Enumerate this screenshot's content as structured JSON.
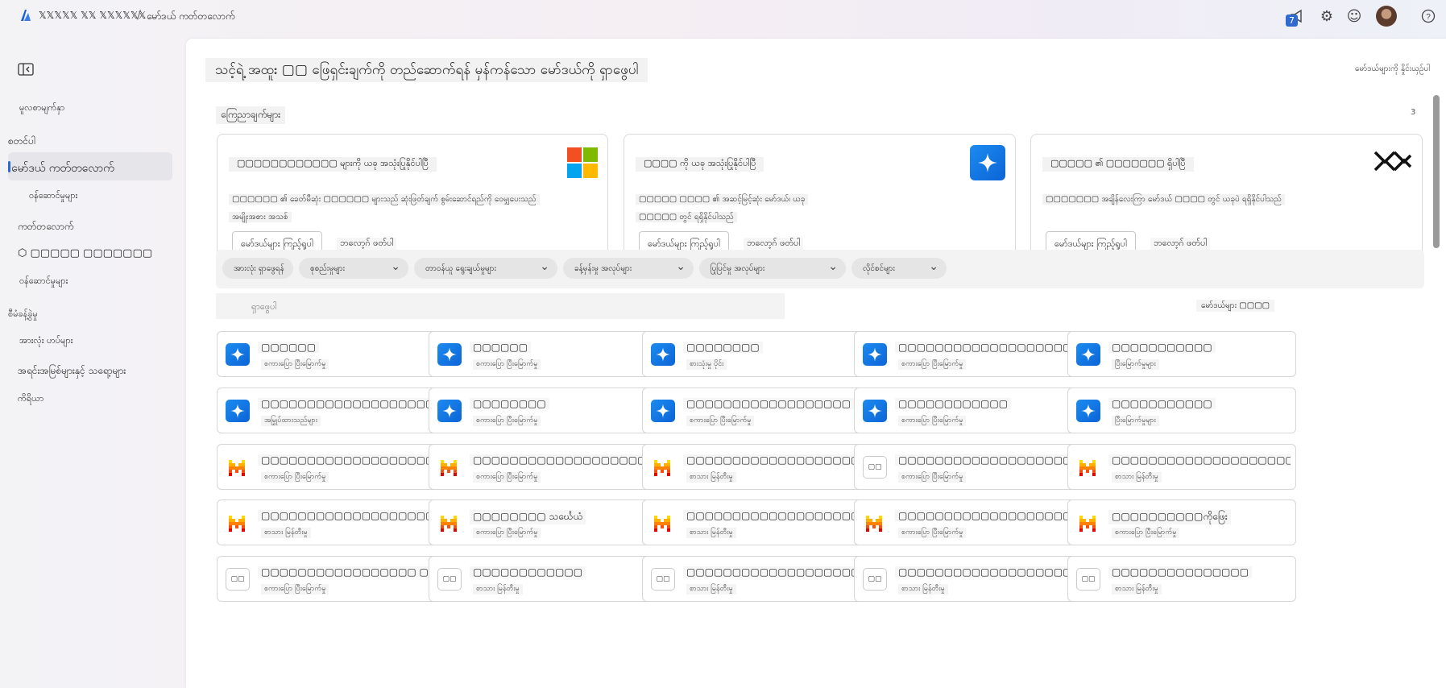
{
  "topbar": {
    "brand": "𝕏𝕏𝕏𝕏𝕏 𝕏𝕏 𝕏𝕏𝕏𝕏𝕏𝕏",
    "breadcrumb": "မော်ဒယ် ကတ်တလောက်",
    "notification_count": "7"
  },
  "sidebar": {
    "items": [
      {
        "label": "မူလစာမျက်နှာ"
      },
      {
        "label": "စတင်ပါ"
      },
      {
        "label": "မော်ဒယ် ကတ်တလောက်"
      },
      {
        "label": "ဝန်ဆောင်မှုများ"
      },
      {
        "label": "ကတ်တလောက်"
      },
      {
        "label": "▢▢▢▢▢ ▢▢▢▢▢▢▢"
      },
      {
        "label": "ဝန်ဆောင်မှုများ"
      }
    ],
    "section_label": "စီမံခန့်ခွဲမှု",
    "bottom_items": [
      {
        "label": "အားလုံး ဟပ်များ"
      },
      {
        "label": "အရင်းအမြစ်များနှင့် သရော့များ"
      },
      {
        "label": "ကိရိယာ"
      }
    ]
  },
  "main": {
    "hero_title": "သင့်ရဲ့ အထူး ▢▢ ဖြေရှင်းချက်ကို တည်ဆောက်ရန် မှန်ကန်သော မော်ဒယ်ကို ရှာဖွေပါ",
    "compare_link": "မော်ဒယ်များကို နှိုင်းယှဉ်ပါ",
    "featured_label": "ကြေညာချက်များ",
    "featured_count": "3",
    "featured": [
      {
        "title": "▢▢▢▢▢▢▢▢▢▢▢▢ များကို ယခု အသုံးပြုနိုင်ပါပြီ",
        "description_1": "▢▢▢▢▢▢ ၏ ခေတ်မီဆုံး ▢▢▢▢▢▢ များသည် ဆုံးဖြတ်ချက် စွမ်းဆောင်ရည်ကို ဝေမျှပေးသည်",
        "description_2": "အမျိုးအစား အသစ်",
        "button": "မော်ဒယ်များ ကြည့်ရှုပါ",
        "link": "ဘလော့ဂ် ဖတ်ပါ"
      },
      {
        "title": "▢▢▢▢ ကို ယခု အသုံးပြုနိုင်ပါပြီ",
        "description_1": "▢▢▢▢▢ ▢▢▢▢ ၏ အဆင့်မြင့်ဆုံး မော်ဒယ်၊ ယခု",
        "description_2": "▢▢▢▢▢ တွင် ရရှိနိုင်ပါသည်",
        "button": "မော်ဒယ်များ ကြည့်ရှုပါ",
        "link": "ဘလော့ဂ် ဖတ်ပါ"
      },
      {
        "title": "▢▢▢▢▢ ၏ ▢▢▢▢▢▢▢ ရှိပါပြီ",
        "description_1": "▢▢▢▢▢▢▢ အချိန်လေးကြာ မော်ဒယ် ▢▢▢▢ တွင် ယခုပဲ ရရှိနိုင်ပါသည်",
        "description_2": "",
        "button": "မော်ဒယ်များ ကြည့်ရှုပါ",
        "link": "ဘလော့ဂ် ဖတ်ပါ"
      }
    ],
    "filters": [
      "အားလုံး ရှာဖွေရန်",
      "စုစည်းမှုများ",
      "တာဝန်ယူ ရွေးချယ်မှုများ",
      "ခန့်မှန်းမှု အလုပ်များ",
      "ပြုပြင်မှု အလုပ်များ",
      "လိုင်စင်များ"
    ],
    "search_placeholder": "ရှာဖွေပါ",
    "model_count": "မော်ဒယ်များ ▢▢▢▢",
    "models": [
      {
        "name": "▢▢▢▢▢▢",
        "task": "စကားပြော ပြီးမြောက်မှု",
        "icon": "star"
      },
      {
        "name": "▢▢▢▢▢▢",
        "task": "စကားပြော ပြီးမြောက်မှု",
        "icon": "star"
      },
      {
        "name": "▢▢▢▢▢▢▢▢",
        "task": "စားသုံးမှု ပိုင်း",
        "icon": "star"
      },
      {
        "name": "▢▢▢▢▢▢▢▢▢▢▢▢▢▢▢▢▢▢▢",
        "task": "စကားပြော ပြီးမြောက်မှု",
        "icon": "star"
      },
      {
        "name": "▢▢▢▢▢▢▢▢▢▢▢",
        "task": "ပြီးမြောက်မှုများ",
        "icon": "star"
      },
      {
        "name": "▢▢▢▢▢▢▢▢▢▢▢▢▢▢▢▢▢▢▢▢▢▢▢",
        "task": "အမြှုပ်ထားသည်များ",
        "icon": "star"
      },
      {
        "name": "▢▢▢▢▢▢▢▢",
        "task": "စကားပြော ပြီးမြောက်မှု",
        "icon": "star"
      },
      {
        "name": "▢▢▢▢▢▢▢▢▢▢▢▢▢▢▢▢▢▢",
        "task": "စကားပြော ပြီးမြောက်မှု",
        "icon": "star"
      },
      {
        "name": "▢▢▢▢▢▢▢▢▢▢▢▢",
        "task": "စကားပြော ပြီးမြောက်မှု",
        "icon": "star"
      },
      {
        "name": "▢▢▢▢▢▢▢▢▢▢▢",
        "task": "ပြီးမြောက်မှုများ",
        "icon": "star"
      },
      {
        "name": "▢▢▢▢▢▢▢▢▢▢▢▢▢▢▢▢▢▢▢▢▢▢▢▢▢▢▢▢",
        "task": "စကားပြော ပြီးမြောက်မှု",
        "icon": "mistral"
      },
      {
        "name": "▢▢▢▢▢▢▢▢▢▢▢▢▢▢▢▢▢▢▢▢▢▢▢▢▢▢",
        "task": "စကားပြော ပြီးမြောက်မှု",
        "icon": "mistral"
      },
      {
        "name": "▢▢▢▢▢▢▢▢▢▢▢▢▢▢▢▢▢▢▢▢▢▢▢▢",
        "task": "စာသား မြန်တီးမှု",
        "icon": "mistral"
      },
      {
        "name": "▢▢▢▢▢▢▢▢▢▢▢▢▢▢▢▢▢▢▢▢▢▢▢▢",
        "task": "စကားပြော ပြီးမြောက်မှု",
        "icon": "plain"
      },
      {
        "name": "▢▢▢▢▢▢▢▢▢▢▢▢▢▢▢▢▢▢▢▢▢▢▢▢▢▢",
        "task": "စာသား မြန်တီးမှု",
        "icon": "mistral"
      },
      {
        "name": "▢▢▢▢▢▢▢▢▢▢▢▢▢▢▢▢▢▢▢▢▢▢▢",
        "task": "စာသား မြန်တီးမှု",
        "icon": "mistral"
      },
      {
        "name": "▢▢▢▢▢▢▢▢ သင်္ဃေယံ",
        "task": "စကားပြော ပြီးမြောက်မှု",
        "icon": "mistral"
      },
      {
        "name": "▢▢▢▢▢▢▢▢▢▢▢▢▢▢▢▢▢▢▢▢▢▢▢▢",
        "task": "စာသား မြန်တီးမှု",
        "icon": "mistral"
      },
      {
        "name": "▢▢▢▢▢▢▢▢▢▢▢▢▢▢▢▢▢▢▢▢▢▢▢▢▢▢",
        "task": "စကားပြော ပြီးမြောက်မှု",
        "icon": "mistral"
      },
      {
        "name": "▢▢▢▢▢▢▢▢▢▢ကိုဖြေး",
        "task": "စကားပြော ပြီးမြောက်မှု",
        "icon": "mistral"
      },
      {
        "name": "▢▢▢▢▢▢▢▢▢▢▢▢▢▢▢▢▢ ▢",
        "task": "စကားပြော ပြီးမြောက်မှု",
        "icon": "plain"
      },
      {
        "name": "▢▢▢▢▢▢▢▢▢▢▢▢",
        "task": "စာသား မြန်တီးမှု",
        "icon": "plain"
      },
      {
        "name": "▢▢▢▢▢▢▢▢▢▢▢▢▢▢▢▢▢▢▢ ▢",
        "task": "စာသား မြန်တီးမှု",
        "icon": "plain"
      },
      {
        "name": "▢▢▢▢▢▢▢▢▢▢▢▢▢▢▢▢▢▢▢▢▢▢▢▢",
        "task": "စာသား မြန်တီးမှု",
        "icon": "plain"
      },
      {
        "name": "▢▢▢▢▢▢▢▢▢▢▢▢▢▢▢",
        "task": "စာသား မြန်တီးမှု",
        "icon": "plain"
      }
    ]
  },
  "colors": {
    "accent": "#2f6ad0",
    "star_icon": "#1576e8",
    "ms_red": "#f25022",
    "ms_green": "#7fba00",
    "ms_blue": "#00a4ef",
    "ms_yellow": "#ffb900",
    "mistral_orange": "#f7861d",
    "mistral_red": "#e10500",
    "mistral_yellow": "#ffd800"
  }
}
